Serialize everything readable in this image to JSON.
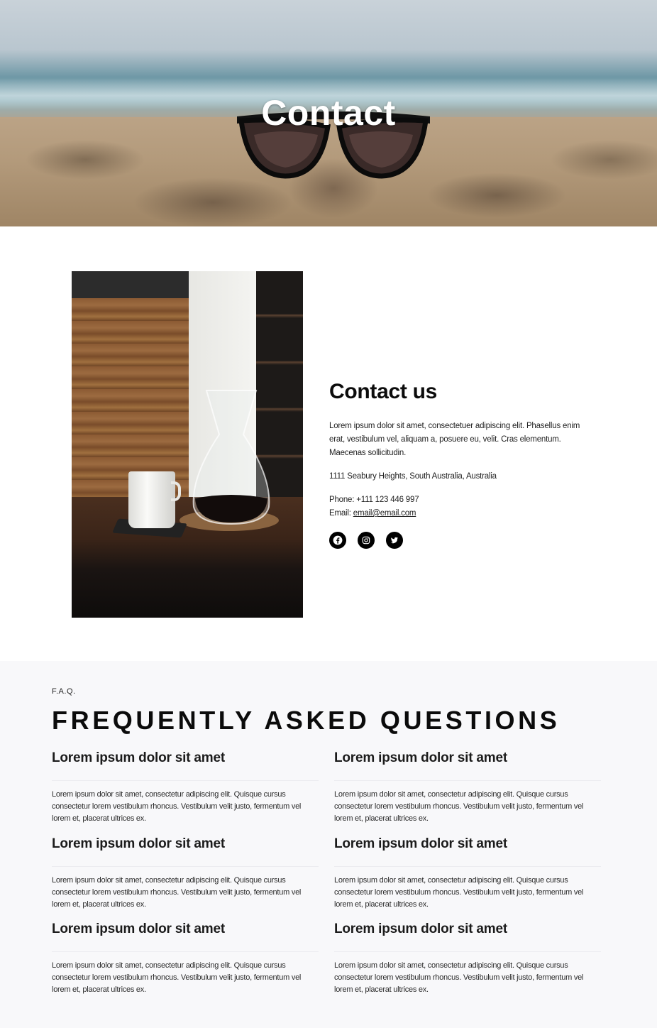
{
  "hero": {
    "title": "Contact"
  },
  "contact": {
    "title": "Contact us",
    "description": "Lorem ipsum dolor sit amet, consectetuer adipiscing elit. Phasellus enim erat, vestibulum vel, aliquam a, posuere eu, velit. Cras elementum. Maecenas sollicitudin.",
    "address": "1111 Seabury Heights, South Australia, Australia",
    "phone_label": "Phone: ",
    "phone": "+111 123 446 997",
    "email_label": "Email: ",
    "email": "email@email.com",
    "socials": [
      {
        "icon": "facebook-icon"
      },
      {
        "icon": "instagram-icon"
      },
      {
        "icon": "twitter-icon"
      }
    ]
  },
  "faq": {
    "eyebrow": "F.A.Q.",
    "title": "FREQUENTLY ASKED QUESTIONS",
    "items": [
      {
        "question": "Lorem ipsum dolor sit amet",
        "answer": "Lorem ipsum dolor sit amet, consectetur adipiscing elit. Quisque cursus consectetur lorem vestibulum rhoncus. Vestibulum velit justo, fermentum vel lorem et, placerat ultrices ex."
      },
      {
        "question": "Lorem ipsum dolor sit amet",
        "answer": "Lorem ipsum dolor sit amet, consectetur adipiscing elit. Quisque cursus consectetur lorem vestibulum rhoncus. Vestibulum velit justo, fermentum vel lorem et, placerat ultrices ex."
      },
      {
        "question": "Lorem ipsum dolor sit amet",
        "answer": "Lorem ipsum dolor sit amet, consectetur adipiscing elit. Quisque cursus consectetur lorem vestibulum rhoncus. Vestibulum velit justo, fermentum vel lorem et, placerat ultrices ex."
      },
      {
        "question": "Lorem ipsum dolor sit amet",
        "answer": "Lorem ipsum dolor sit amet, consectetur adipiscing elit. Quisque cursus consectetur lorem vestibulum rhoncus. Vestibulum velit justo, fermentum vel lorem et, placerat ultrices ex."
      },
      {
        "question": "Lorem ipsum dolor sit amet",
        "answer": "Lorem ipsum dolor sit amet, consectetur adipiscing elit. Quisque cursus consectetur lorem vestibulum rhoncus. Vestibulum velit justo, fermentum vel lorem et, placerat ultrices ex."
      },
      {
        "question": "Lorem ipsum dolor sit amet",
        "answer": "Lorem ipsum dolor sit amet, consectetur adipiscing elit. Quisque cursus consectetur lorem vestibulum rhoncus. Vestibulum velit justo, fermentum vel lorem et, placerat ultrices ex."
      }
    ]
  }
}
